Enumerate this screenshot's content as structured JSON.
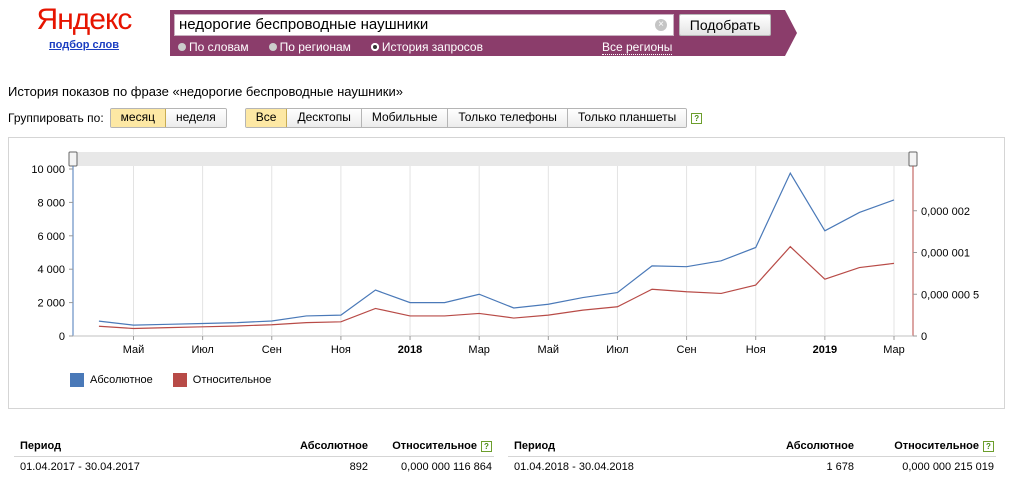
{
  "logo": {
    "word": "Яндекс",
    "subtitle": "подбор слов"
  },
  "search": {
    "query": "недорогие беспроводные наушники",
    "button": "Подобрать"
  },
  "modes": [
    {
      "label": "По словам",
      "selected": false
    },
    {
      "label": "По регионам",
      "selected": false
    },
    {
      "label": "История запросов",
      "selected": true
    }
  ],
  "regions_link": "Все регионы",
  "page_title": "История показов по фразе «недорогие беспроводные наушники»",
  "group": {
    "label": "Группировать по:",
    "period_options": [
      {
        "label": "месяц",
        "on": true
      },
      {
        "label": "неделя",
        "on": false
      }
    ],
    "device_options": [
      {
        "label": "Все",
        "on": true
      },
      {
        "label": "Десктопы",
        "on": false
      },
      {
        "label": "Мобильные",
        "on": false
      },
      {
        "label": "Только телефоны",
        "on": false
      },
      {
        "label": "Только планшеты",
        "on": false
      }
    ],
    "help": "?"
  },
  "colors": {
    "absolute": "#4a79b8",
    "relative": "#b84b47",
    "brand": "#8b3d6b"
  },
  "chart_data": {
    "type": "line",
    "x": [
      "2017-04",
      "2017-05",
      "2017-06",
      "2017-07",
      "2017-08",
      "2017-09",
      "2017-10",
      "2017-11",
      "2017-12",
      "2018-01",
      "2018-02",
      "2018-03",
      "2018-04",
      "2018-05",
      "2018-06",
      "2018-07",
      "2018-08",
      "2018-09",
      "2018-10",
      "2018-11",
      "2018-12",
      "2019-01",
      "2019-02",
      "2019-03"
    ],
    "x_ticks": [
      {
        "x": "2017-05",
        "label": "Май"
      },
      {
        "x": "2017-07",
        "label": "Июл"
      },
      {
        "x": "2017-09",
        "label": "Сен"
      },
      {
        "x": "2017-11",
        "label": "Ноя"
      },
      {
        "x": "2018-01",
        "label": "2018",
        "bold": true
      },
      {
        "x": "2018-03",
        "label": "Мар"
      },
      {
        "x": "2018-05",
        "label": "Май"
      },
      {
        "x": "2018-07",
        "label": "Июл"
      },
      {
        "x": "2018-09",
        "label": "Сен"
      },
      {
        "x": "2018-11",
        "label": "Ноя"
      },
      {
        "x": "2019-01",
        "label": "2019",
        "bold": true
      },
      {
        "x": "2019-03",
        "label": "Мар"
      }
    ],
    "series": [
      {
        "name": "Абсолютное",
        "axis": "left",
        "values": [
          892,
          650,
          700,
          750,
          800,
          900,
          1200,
          1250,
          2750,
          2000,
          2000,
          2500,
          1678,
          1900,
          2300,
          2600,
          4200,
          4150,
          4500,
          5300,
          9750,
          6300,
          7400,
          8150
        ]
      },
      {
        "name": "Относительное",
        "axis": "right",
        "values": [
          1.16864e-07,
          9e-08,
          1e-07,
          1.1e-07,
          1.2e-07,
          1.35e-07,
          1.6e-07,
          1.7e-07,
          3.3e-07,
          2.4e-07,
          2.4e-07,
          2.7e-07,
          2.15019e-07,
          2.5e-07,
          3.1e-07,
          3.5e-07,
          5.6e-07,
          5.3e-07,
          5.1e-07,
          6.1e-07,
          1.07e-06,
          6.8e-07,
          8.2e-07,
          8.7e-07
        ]
      }
    ],
    "y_left": {
      "ticks": [
        0,
        2000,
        4000,
        6000,
        8000,
        10000
      ],
      "labels": [
        "0",
        "2 000",
        "4 000",
        "6 000",
        "8 000",
        "10 000"
      ],
      "max": 10000
    },
    "y_right": {
      "ticks": [
        0,
        5e-07,
        1e-06,
        1.5e-06
      ],
      "labels": [
        "0",
        "0,000 000 5",
        "0,000 001",
        "0,000 002"
      ],
      "max": 1.5e-06
    },
    "legend_position": "bottom-left"
  },
  "legend": [
    {
      "label": "Абсолютное"
    },
    {
      "label": "Относительное"
    }
  ],
  "table": {
    "headers": {
      "period": "Период",
      "absolute": "Абсолютное",
      "relative": "Относительное"
    },
    "left_row": {
      "period": "01.04.2017 - 30.04.2017",
      "absolute": "892",
      "relative": "0,000 000 116 864"
    },
    "right_row": {
      "period": "01.04.2018 - 30.04.2018",
      "absolute": "1 678",
      "relative": "0,000 000 215 019"
    }
  }
}
